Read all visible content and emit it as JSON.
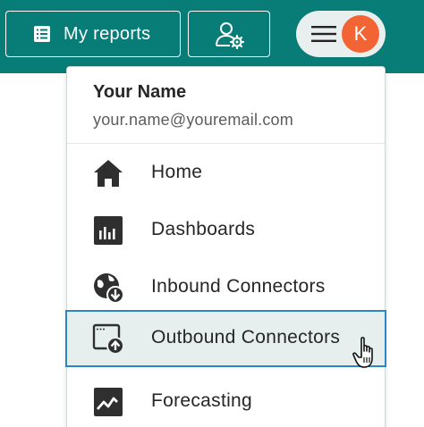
{
  "topbar": {
    "reports_label": "My reports",
    "reports_icon": "report-list-icon",
    "user_settings_icon": "user-gear-icon",
    "menu_icon": "hamburger-icon",
    "avatar_initial": "K",
    "colors": {
      "bar": "#087d77",
      "avatar": "#f26433",
      "pill": "#e9efee"
    }
  },
  "dropdown": {
    "user": {
      "name": "Your Name",
      "email": "your.name@youremail.com"
    },
    "items": [
      {
        "label": "Home",
        "icon": "home-icon"
      },
      {
        "label": "Dashboards",
        "icon": "dashboard-icon"
      },
      {
        "label": "Inbound Connectors",
        "icon": "globe-download-icon"
      },
      {
        "label": "Outbound Connectors",
        "icon": "window-upload-icon",
        "hovered": true
      },
      {
        "label": "Forecasting",
        "icon": "trend-chart-icon"
      }
    ],
    "colors": {
      "highlight_bg": "#e6eeee",
      "highlight_border": "#2b86c5"
    }
  }
}
